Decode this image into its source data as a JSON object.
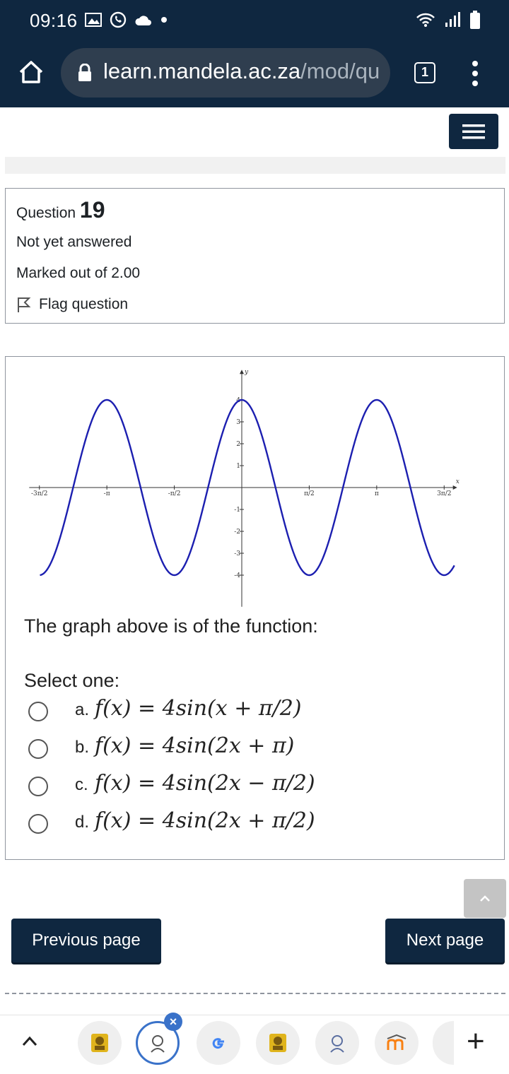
{
  "status_bar": {
    "time": "09:16"
  },
  "browser": {
    "url_host": "learn.mandela.ac.za",
    "url_path": "/mod/qu",
    "tab_count": "1"
  },
  "question": {
    "label": "Question",
    "number": "19",
    "state": "Not yet answered",
    "grade": "Marked out of 2.00",
    "flag_label": "Flag question",
    "text": "The graph above is of the function:",
    "select_prompt": "Select one:",
    "options": [
      {
        "letter": "a.",
        "expr": "f(x) = 4sin(x + π/2)"
      },
      {
        "letter": "b.",
        "expr": "f(x) = 4sin(2x + π)"
      },
      {
        "letter": "c.",
        "expr": "f(x) = 4sin(2x − π/2)"
      },
      {
        "letter": "d.",
        "expr": "f(x) = 4sin(2x + π/2)"
      }
    ]
  },
  "navigation": {
    "previous_label": "Previous page",
    "next_label": "Next page"
  },
  "chart_data": {
    "type": "line",
    "title": "",
    "xlabel": "x",
    "ylabel": "y",
    "xlim": [
      -4.95,
      4.95
    ],
    "ylim": [
      -4.8,
      4.8
    ],
    "x_ticks": [
      "-3π/2",
      "-π",
      "-π/2",
      "π/2",
      "π",
      "3π/2"
    ],
    "y_ticks": [
      "4",
      "3",
      "2",
      "1",
      "-1",
      "-2",
      "-3",
      "-4"
    ],
    "series": [
      {
        "expression": "4cos(2x)",
        "color": "#1c1fb0",
        "x_range": [
          -4.7,
          4.95
        ]
      }
    ]
  },
  "colors": {
    "brand_dark": "#0f2740",
    "curve": "#1c1fb0"
  }
}
